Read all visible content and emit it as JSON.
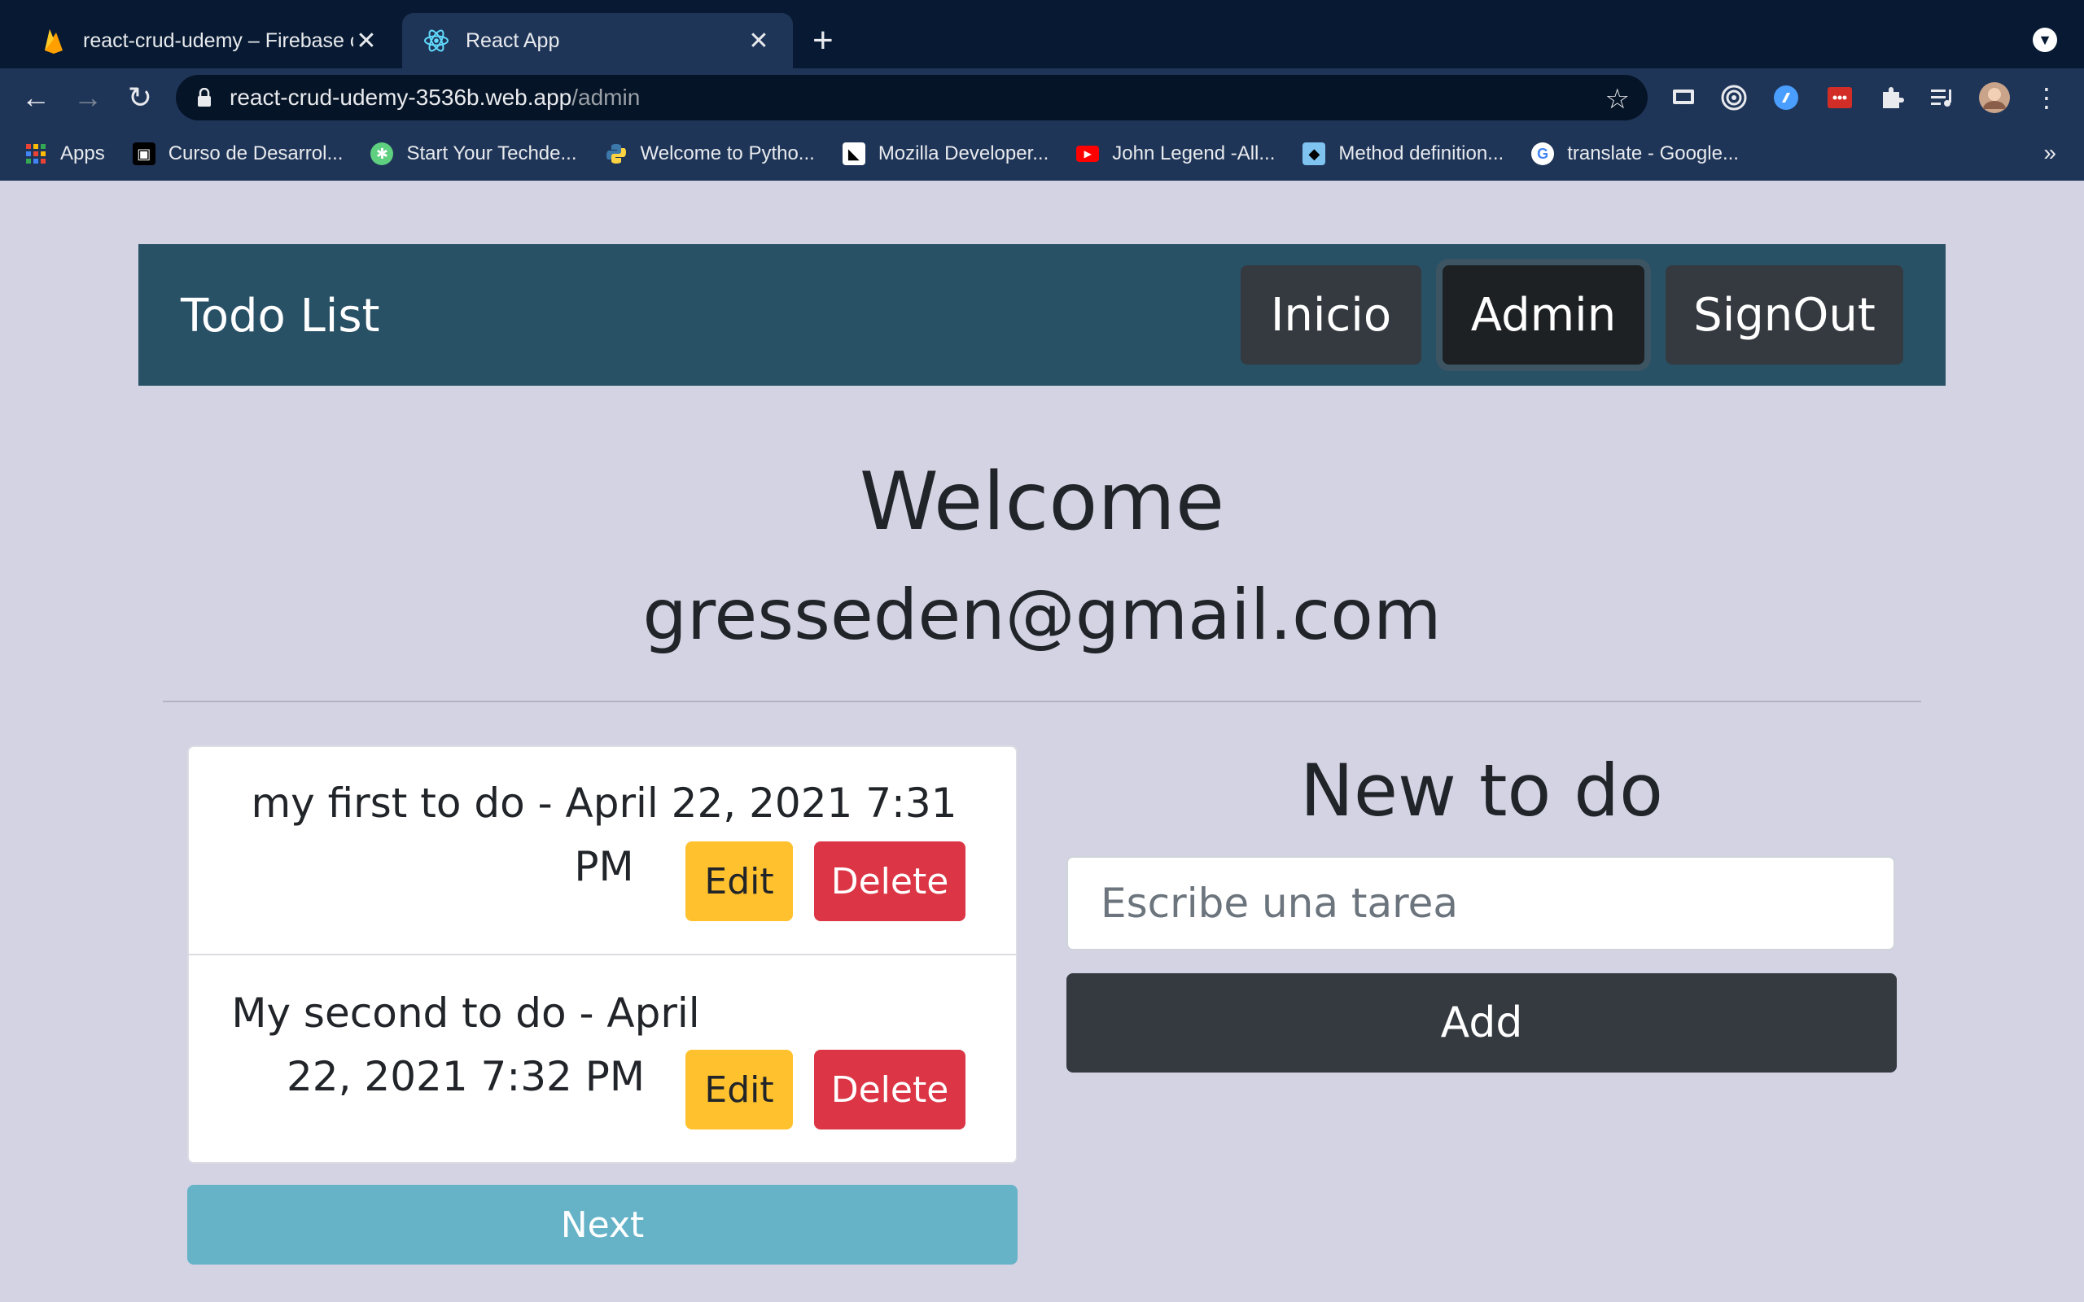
{
  "browser": {
    "tabs": [
      {
        "title": "react-crud-udemy – Firebase c",
        "icon": "firebase-icon",
        "active": false
      },
      {
        "title": "React App",
        "icon": "react-icon",
        "active": true
      }
    ],
    "url": {
      "host": "react-crud-udemy-3536b.web.app",
      "path": "/admin"
    },
    "bookmarks": [
      {
        "label": "Apps",
        "icon": "apps-grid-icon"
      },
      {
        "label": "Curso de Desarrol...",
        "icon": "robot-icon"
      },
      {
        "label": "Start Your Techde...",
        "icon": "techdegree-icon"
      },
      {
        "label": "Welcome to Pytho...",
        "icon": "python-icon"
      },
      {
        "label": "Mozilla Developer...",
        "icon": "mdn-icon"
      },
      {
        "label": "John Legend -All...",
        "icon": "youtube-icon"
      },
      {
        "label": "Method definition...",
        "icon": "method-icon"
      },
      {
        "label": "translate - Google...",
        "icon": "google-icon"
      }
    ],
    "bookmarks_more": "»"
  },
  "app": {
    "brand": "Todo List",
    "nav": {
      "inicio": "Inicio",
      "admin": "Admin",
      "signout": "SignOut"
    },
    "welcome": "Welcome",
    "email": "gresseden@gmail.com",
    "todos": [
      {
        "text": "my first to do - April 22, 2021 7:31 PM",
        "edit": "Edit",
        "delete": "Delete"
      },
      {
        "text": "My second to do - April 22, 2021 7:32 PM",
        "edit": "Edit",
        "delete": "Delete"
      }
    ],
    "next": "Next",
    "new_todo": {
      "title": "New to do",
      "placeholder": "Escribe una tarea",
      "value": "",
      "add": "Add"
    }
  },
  "colors": {
    "page_bg": "#d3d3e4",
    "navbar": "#295166",
    "dark_btn": "#343a40",
    "warning": "#ffc12e",
    "danger": "#dc3545",
    "info": "#66b3c8"
  }
}
